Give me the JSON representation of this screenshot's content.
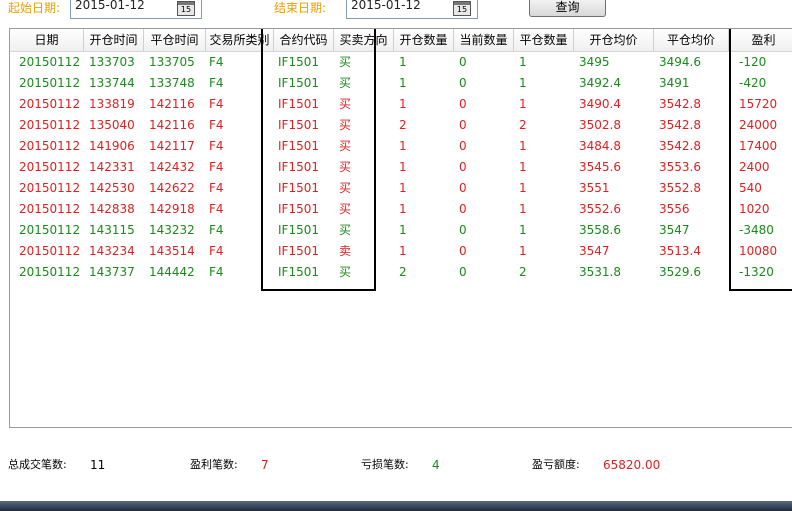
{
  "filters": {
    "start_label": "起始日期:",
    "start_value": "2015-01-12",
    "end_label": "结束日期:",
    "end_value": "2015-01-12",
    "calendar_icon_text": "15",
    "query_label": "查询"
  },
  "table": {
    "columns": [
      "日期",
      "开仓时间",
      "平仓时间",
      "交易所类别",
      "合约代码",
      "买卖方向",
      "开仓数量",
      "当前数量",
      "平仓数量",
      "开仓均价",
      "平仓均价",
      "盈利"
    ],
    "rows": [
      {
        "color": "green",
        "cells": [
          "20150112",
          "133703",
          "133705",
          "F4",
          "IF1501",
          "买",
          "1",
          "0",
          "1",
          "3495",
          "3494.6",
          "-120"
        ]
      },
      {
        "color": "green",
        "cells": [
          "20150112",
          "133744",
          "133748",
          "F4",
          "IF1501",
          "买",
          "1",
          "0",
          "1",
          "3492.4",
          "3491",
          "-420"
        ]
      },
      {
        "color": "red",
        "cells": [
          "20150112",
          "133819",
          "142116",
          "F4",
          "IF1501",
          "买",
          "1",
          "0",
          "1",
          "3490.4",
          "3542.8",
          "15720"
        ]
      },
      {
        "color": "red",
        "cells": [
          "20150112",
          "135040",
          "142116",
          "F4",
          "IF1501",
          "买",
          "2",
          "0",
          "2",
          "3502.8",
          "3542.8",
          "24000"
        ]
      },
      {
        "color": "red",
        "cells": [
          "20150112",
          "141906",
          "142117",
          "F4",
          "IF1501",
          "买",
          "1",
          "0",
          "1",
          "3484.8",
          "3542.8",
          "17400"
        ]
      },
      {
        "color": "red",
        "cells": [
          "20150112",
          "142331",
          "142432",
          "F4",
          "IF1501",
          "买",
          "1",
          "0",
          "1",
          "3545.6",
          "3553.6",
          "2400"
        ]
      },
      {
        "color": "red",
        "cells": [
          "20150112",
          "142530",
          "142622",
          "F4",
          "IF1501",
          "买",
          "1",
          "0",
          "1",
          "3551",
          "3552.8",
          "540"
        ]
      },
      {
        "color": "red",
        "cells": [
          "20150112",
          "142838",
          "142918",
          "F4",
          "IF1501",
          "买",
          "1",
          "0",
          "1",
          "3552.6",
          "3556",
          "1020"
        ]
      },
      {
        "color": "green",
        "cells": [
          "20150112",
          "143115",
          "143232",
          "F4",
          "IF1501",
          "买",
          "1",
          "0",
          "1",
          "3558.6",
          "3547",
          "-3480"
        ]
      },
      {
        "color": "red",
        "cells": [
          "20150112",
          "143234",
          "143514",
          "F4",
          "IF1501",
          "卖",
          "1",
          "0",
          "1",
          "3547",
          "3513.4",
          "10080"
        ]
      },
      {
        "color": "green",
        "cells": [
          "20150112",
          "143737",
          "144442",
          "F4",
          "IF1501",
          "买",
          "2",
          "0",
          "2",
          "3531.8",
          "3529.6",
          "-1320"
        ]
      }
    ]
  },
  "summary": {
    "total_label": "总成交笔数:",
    "total_value": "11",
    "win_label": "盈利笔数:",
    "win_value": "7",
    "loss_label": "亏损笔数:",
    "loss_value": "4",
    "pnl_label": "盈亏额度:",
    "pnl_value": "65820.00"
  },
  "colors": {
    "profit": "#e02020",
    "loss": "#1a8a1a",
    "label_accent": "#e8a000"
  }
}
